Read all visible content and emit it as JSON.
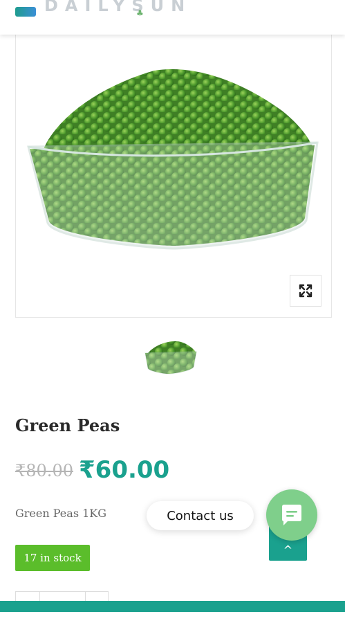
{
  "header": {
    "logo_text": "DAILYSUN"
  },
  "product": {
    "title": "Green Peas",
    "old_price": "₹80.00",
    "new_price": "₹60.00",
    "description": "Green Peas 1KG",
    "stock": "17 in stock"
  },
  "colors": {
    "accent": "#1aa18e",
    "stock_badge": "#5bbd2b",
    "chat": "#7fcf8b"
  },
  "icons": {
    "zoom": "expand-icon",
    "chat": "chat-bubble-icon",
    "back_to_top": "chevron-up-icon"
  },
  "widgets": {
    "contact_label": "Contact us",
    "back_to_top_symbol": "^"
  }
}
